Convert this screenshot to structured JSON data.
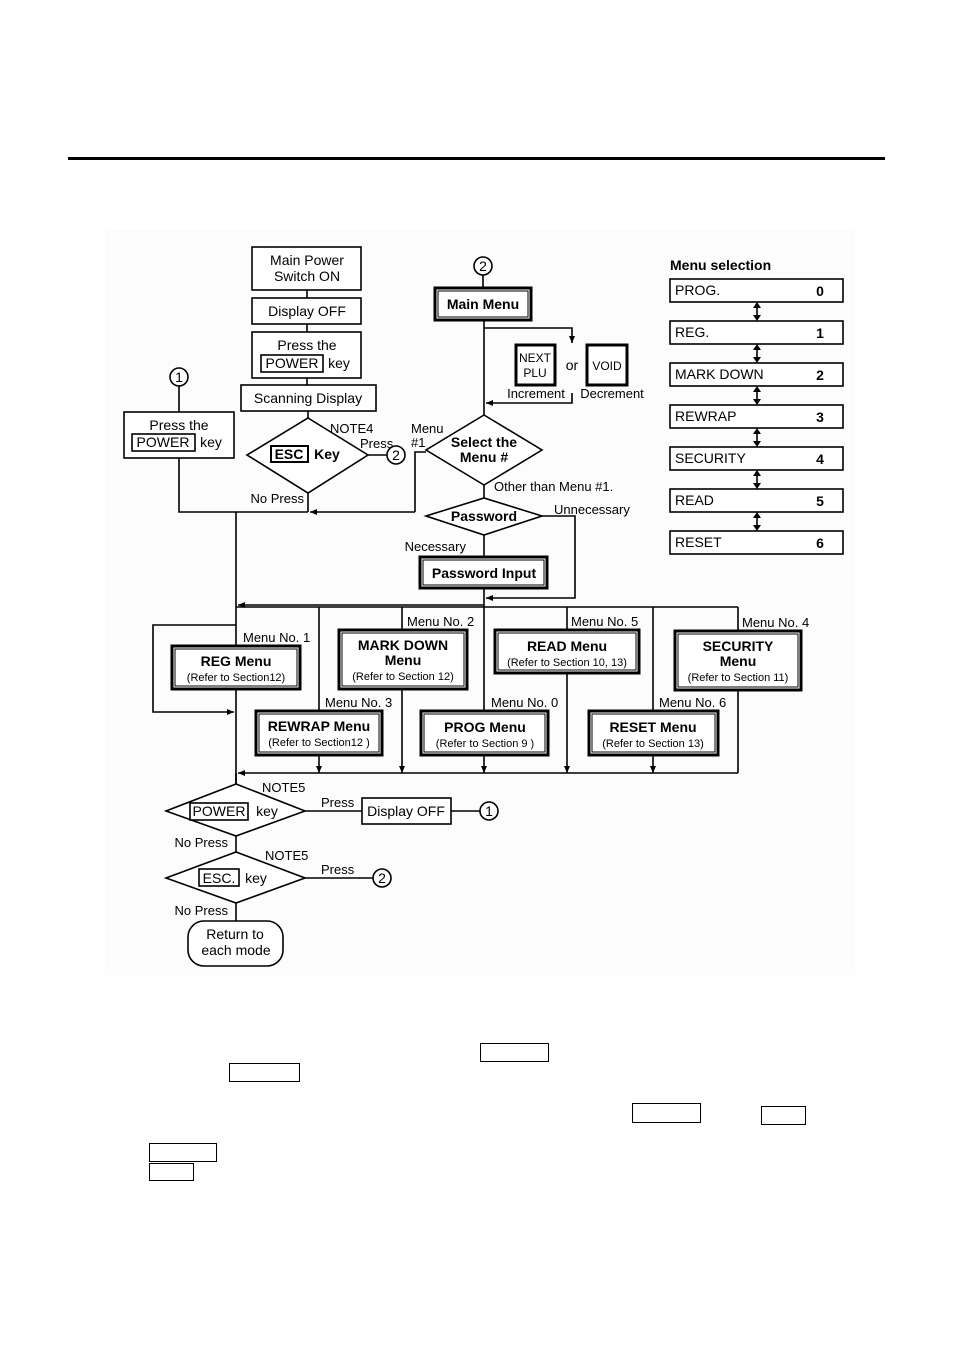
{
  "flowchart": {
    "start": {
      "main_power": [
        "Main Power",
        "Switch ON"
      ],
      "display_off": "Display OFF",
      "press_power": {
        "line1": "Press the",
        "key": "POWER",
        "suffix": "key"
      },
      "scanning_display": "Scanning Display"
    },
    "connector_1_label": "1",
    "connector_2_label": "2",
    "left_press_power": {
      "line1": "Press the",
      "key": "POWER",
      "suffix": "key"
    },
    "esc_decision": {
      "key": "ESC",
      "suffix": "Key",
      "note": "NOTE4",
      "press": "Press",
      "no_press": "No Press"
    },
    "main_menu": "Main Menu",
    "increment_key": {
      "line1": "NEXT",
      "line2": "PLU",
      "caption": "Increment"
    },
    "or_label": "or",
    "decrement_key": {
      "label": "VOID",
      "caption": "Decrement"
    },
    "select_menu": {
      "line1": "Select the",
      "line2": "Menu #",
      "menu1_label_line1": "Menu",
      "menu1_label_line2": "#1",
      "other": "Other than Menu #1."
    },
    "password": {
      "label": "Password",
      "unnecessary": "Unnecessary",
      "necessary": "Necessary",
      "input": "Password Input"
    },
    "menus": [
      {
        "no": "Menu No. 1",
        "title": [
          "REG Menu"
        ],
        "ref": "(Refer to Section12)"
      },
      {
        "no": "Menu No. 2",
        "title": [
          "MARK DOWN",
          "Menu"
        ],
        "ref": "(Refer to Section 12)"
      },
      {
        "no": "Menu No. 5",
        "title": [
          "READ Menu"
        ],
        "ref": "(Refer to Section 10, 13)"
      },
      {
        "no": "Menu No. 4",
        "title": [
          "SECURITY",
          "Menu"
        ],
        "ref": "(Refer to Section 11)"
      },
      {
        "no": "Menu No. 3",
        "title": [
          "REWRAP Menu"
        ],
        "ref": "(Refer to Section12 )"
      },
      {
        "no": "Menu No. 0",
        "title": [
          "PROG Menu"
        ],
        "ref": "(Refer to Section  9 )"
      },
      {
        "no": "Menu No. 6",
        "title": [
          "RESET Menu"
        ],
        "ref": "(Refer to Section 13)"
      }
    ],
    "power_decision": {
      "key": "POWER",
      "suffix": "key",
      "note": "NOTE5",
      "press": "Press",
      "no_press": "No Press",
      "result": "Display OFF"
    },
    "esc2_decision": {
      "key": "ESC.",
      "suffix": "key",
      "note": "NOTE5",
      "press": "Press",
      "no_press": "No Press"
    },
    "return_box": [
      "Return to",
      "each mode"
    ]
  },
  "menu_selection": {
    "title": "Menu selection",
    "items": [
      {
        "label": "PROG.",
        "number": "0"
      },
      {
        "label": "REG.",
        "number": "1"
      },
      {
        "label": "MARK DOWN",
        "number": "2"
      },
      {
        "label": "REWRAP",
        "number": "3"
      },
      {
        "label": "SECURITY",
        "number": "4"
      },
      {
        "label": "READ",
        "number": "5"
      },
      {
        "label": "RESET",
        "number": "6"
      }
    ]
  }
}
